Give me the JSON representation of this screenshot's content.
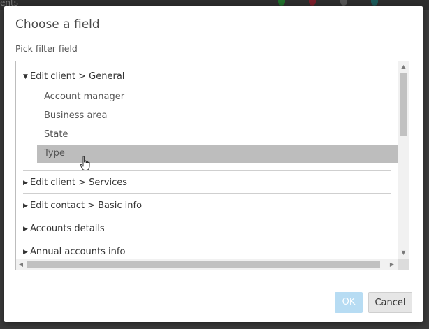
{
  "background": {
    "partial_label": "ents"
  },
  "dialog": {
    "title": "Choose a field",
    "subtitle": "Pick filter field",
    "tree": {
      "expanded_group": {
        "label": "Edit client > General",
        "items": [
          "Account manager",
          "Business area",
          "State",
          "Type"
        ],
        "selected_item": "Type"
      },
      "collapsed_groups": [
        "Edit client > Services",
        "Edit contact > Basic info",
        "Accounts details",
        "Annual accounts info"
      ]
    },
    "buttons": {
      "ok": "OK",
      "cancel": "Cancel"
    }
  },
  "colors": {
    "selected_row": "#bdbdbd",
    "ok_button": "#b7dcf3",
    "cancel_button": "#e6e6e6"
  }
}
